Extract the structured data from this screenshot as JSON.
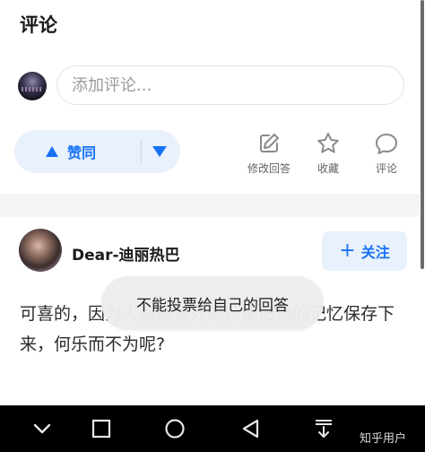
{
  "section": {
    "title": "评论"
  },
  "comment_box": {
    "placeholder": "添加评论..."
  },
  "vote": {
    "up_label": "赞同"
  },
  "actions": {
    "edit": "修改回答",
    "favorite": "收藏",
    "comment": "评论"
  },
  "author": {
    "name": "Dear-迪丽热巴"
  },
  "follow": {
    "label": "关注",
    "plus": "+"
  },
  "answer": {
    "text": "可喜的，因为人都是要死的，能把他的记忆保存下来，何乐而不为呢?"
  },
  "toast": {
    "message": "不能投票给自己的回答"
  },
  "watermark": {
    "text": "知乎用户"
  },
  "colors": {
    "accent": "#1772f6",
    "pill_bg": "#e8f1fc",
    "navbar": "#000000"
  }
}
